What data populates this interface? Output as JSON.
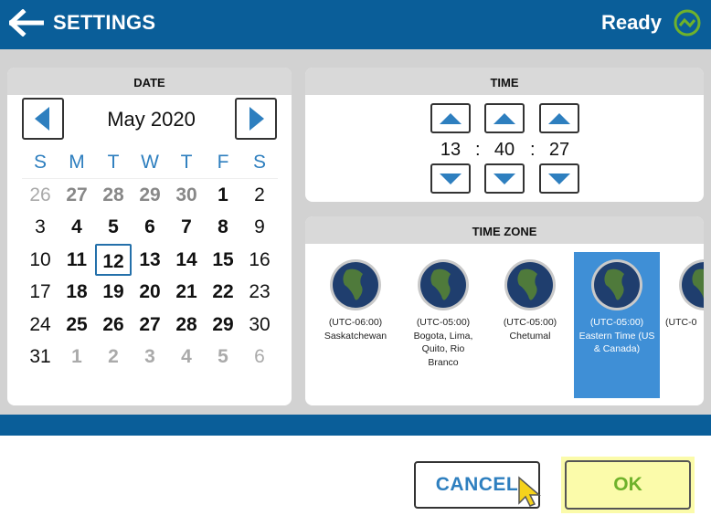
{
  "header": {
    "title": "SETTINGS",
    "status": "Ready",
    "back_icon": "left-arrow-icon",
    "status_icon": "power-status-icon"
  },
  "date": {
    "heading": "DATE",
    "month_label": "May 2020",
    "weekdays": [
      "S",
      "M",
      "T",
      "W",
      "T",
      "F",
      "S"
    ],
    "weeks": [
      [
        "26",
        "27",
        "28",
        "29",
        "30",
        "1",
        "2"
      ],
      [
        "3",
        "4",
        "5",
        "6",
        "7",
        "8",
        "9"
      ],
      [
        "10",
        "11",
        "12",
        "13",
        "14",
        "15",
        "16"
      ],
      [
        "17",
        "18",
        "19",
        "20",
        "21",
        "22",
        "23"
      ],
      [
        "24",
        "25",
        "26",
        "27",
        "28",
        "29",
        "30"
      ],
      [
        "31",
        "1",
        "2",
        "3",
        "4",
        "5",
        "6"
      ]
    ],
    "selected_day": "12"
  },
  "time": {
    "heading": "TIME",
    "hour": "13",
    "minute": "40",
    "second": "27",
    "separator": ":"
  },
  "timezone": {
    "heading": "TIME ZONE",
    "items": [
      {
        "label_line1": "(UTC-06:00)",
        "label_line2": "Saskatchewan",
        "label_line3": "",
        "label_line4": ""
      },
      {
        "label_line1": "(UTC-05:00)",
        "label_line2": "Bogota, Lima,",
        "label_line3": "Quito, Rio",
        "label_line4": "Branco"
      },
      {
        "label_line1": "(UTC-05:00)",
        "label_line2": "Chetumal",
        "label_line3": "",
        "label_line4": ""
      },
      {
        "label_line1": "(UTC-05:00)",
        "label_line2": "Eastern Time (US",
        "label_line3": "& Canada)",
        "label_line4": ""
      },
      {
        "label_line1": "(UTC-0",
        "label_line2": "",
        "label_line3": "",
        "label_line4": ""
      }
    ],
    "selected_index": 3
  },
  "footer": {
    "cancel_label": "CANCEL",
    "ok_label": "OK"
  },
  "colors": {
    "brand_blue": "#0a5e99",
    "accent_blue": "#2e7fbf",
    "selected_blue": "#3f8fd6",
    "status_green": "#6fb22b",
    "ok_highlight": "#fbfbaa"
  }
}
